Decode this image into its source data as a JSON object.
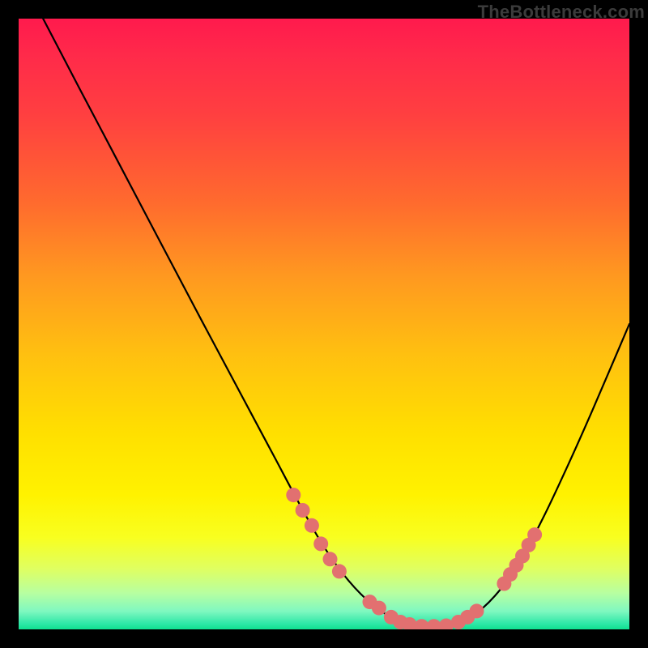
{
  "watermark": "TheBottleneck.com",
  "chart_data": {
    "type": "line",
    "title": "",
    "xlabel": "",
    "ylabel": "",
    "xlim": [
      0,
      100
    ],
    "ylim": [
      0,
      100
    ],
    "series": [
      {
        "name": "bottleneck-curve",
        "x": [
          4,
          10,
          20,
          30,
          38,
          42,
          46,
          50,
          54,
          58,
          62,
          66,
          70,
          74,
          78,
          82,
          86,
          90,
          94,
          100
        ],
        "y": [
          100,
          88.5,
          69.5,
          50.5,
          35.5,
          28,
          20.5,
          13.5,
          8,
          4,
          1.5,
          0.5,
          0.5,
          2,
          5.5,
          11,
          18.5,
          27,
          36,
          50
        ]
      }
    ],
    "markers": [
      {
        "name": "highlight-dots-left",
        "color": "#e27070",
        "points": [
          {
            "x": 45.0,
            "y": 22.0
          },
          {
            "x": 46.5,
            "y": 19.5
          },
          {
            "x": 48.0,
            "y": 17.0
          },
          {
            "x": 49.5,
            "y": 14.0
          },
          {
            "x": 51.0,
            "y": 11.5
          },
          {
            "x": 52.5,
            "y": 9.5
          }
        ]
      },
      {
        "name": "highlight-dots-bottom",
        "color": "#e27070",
        "points": [
          {
            "x": 57.5,
            "y": 4.5
          },
          {
            "x": 59.0,
            "y": 3.5
          },
          {
            "x": 61.0,
            "y": 2.0
          },
          {
            "x": 62.5,
            "y": 1.2
          },
          {
            "x": 64.0,
            "y": 0.8
          },
          {
            "x": 66.0,
            "y": 0.5
          },
          {
            "x": 68.0,
            "y": 0.5
          },
          {
            "x": 70.0,
            "y": 0.6
          },
          {
            "x": 72.0,
            "y": 1.2
          },
          {
            "x": 73.5,
            "y": 2.0
          },
          {
            "x": 75.0,
            "y": 3.0
          }
        ]
      },
      {
        "name": "highlight-dots-right",
        "color": "#e27070",
        "points": [
          {
            "x": 79.5,
            "y": 7.5
          },
          {
            "x": 80.5,
            "y": 9.0
          },
          {
            "x": 81.5,
            "y": 10.5
          },
          {
            "x": 82.5,
            "y": 12.0
          },
          {
            "x": 83.5,
            "y": 13.8
          },
          {
            "x": 84.5,
            "y": 15.5
          }
        ]
      }
    ],
    "background": {
      "type": "vertical-gradient",
      "stops": [
        {
          "pos": 0.0,
          "color": "#ff1a4d"
        },
        {
          "pos": 0.5,
          "color": "#ffc010"
        },
        {
          "pos": 0.78,
          "color": "#fff200"
        },
        {
          "pos": 1.0,
          "color": "#10e090"
        }
      ]
    }
  }
}
